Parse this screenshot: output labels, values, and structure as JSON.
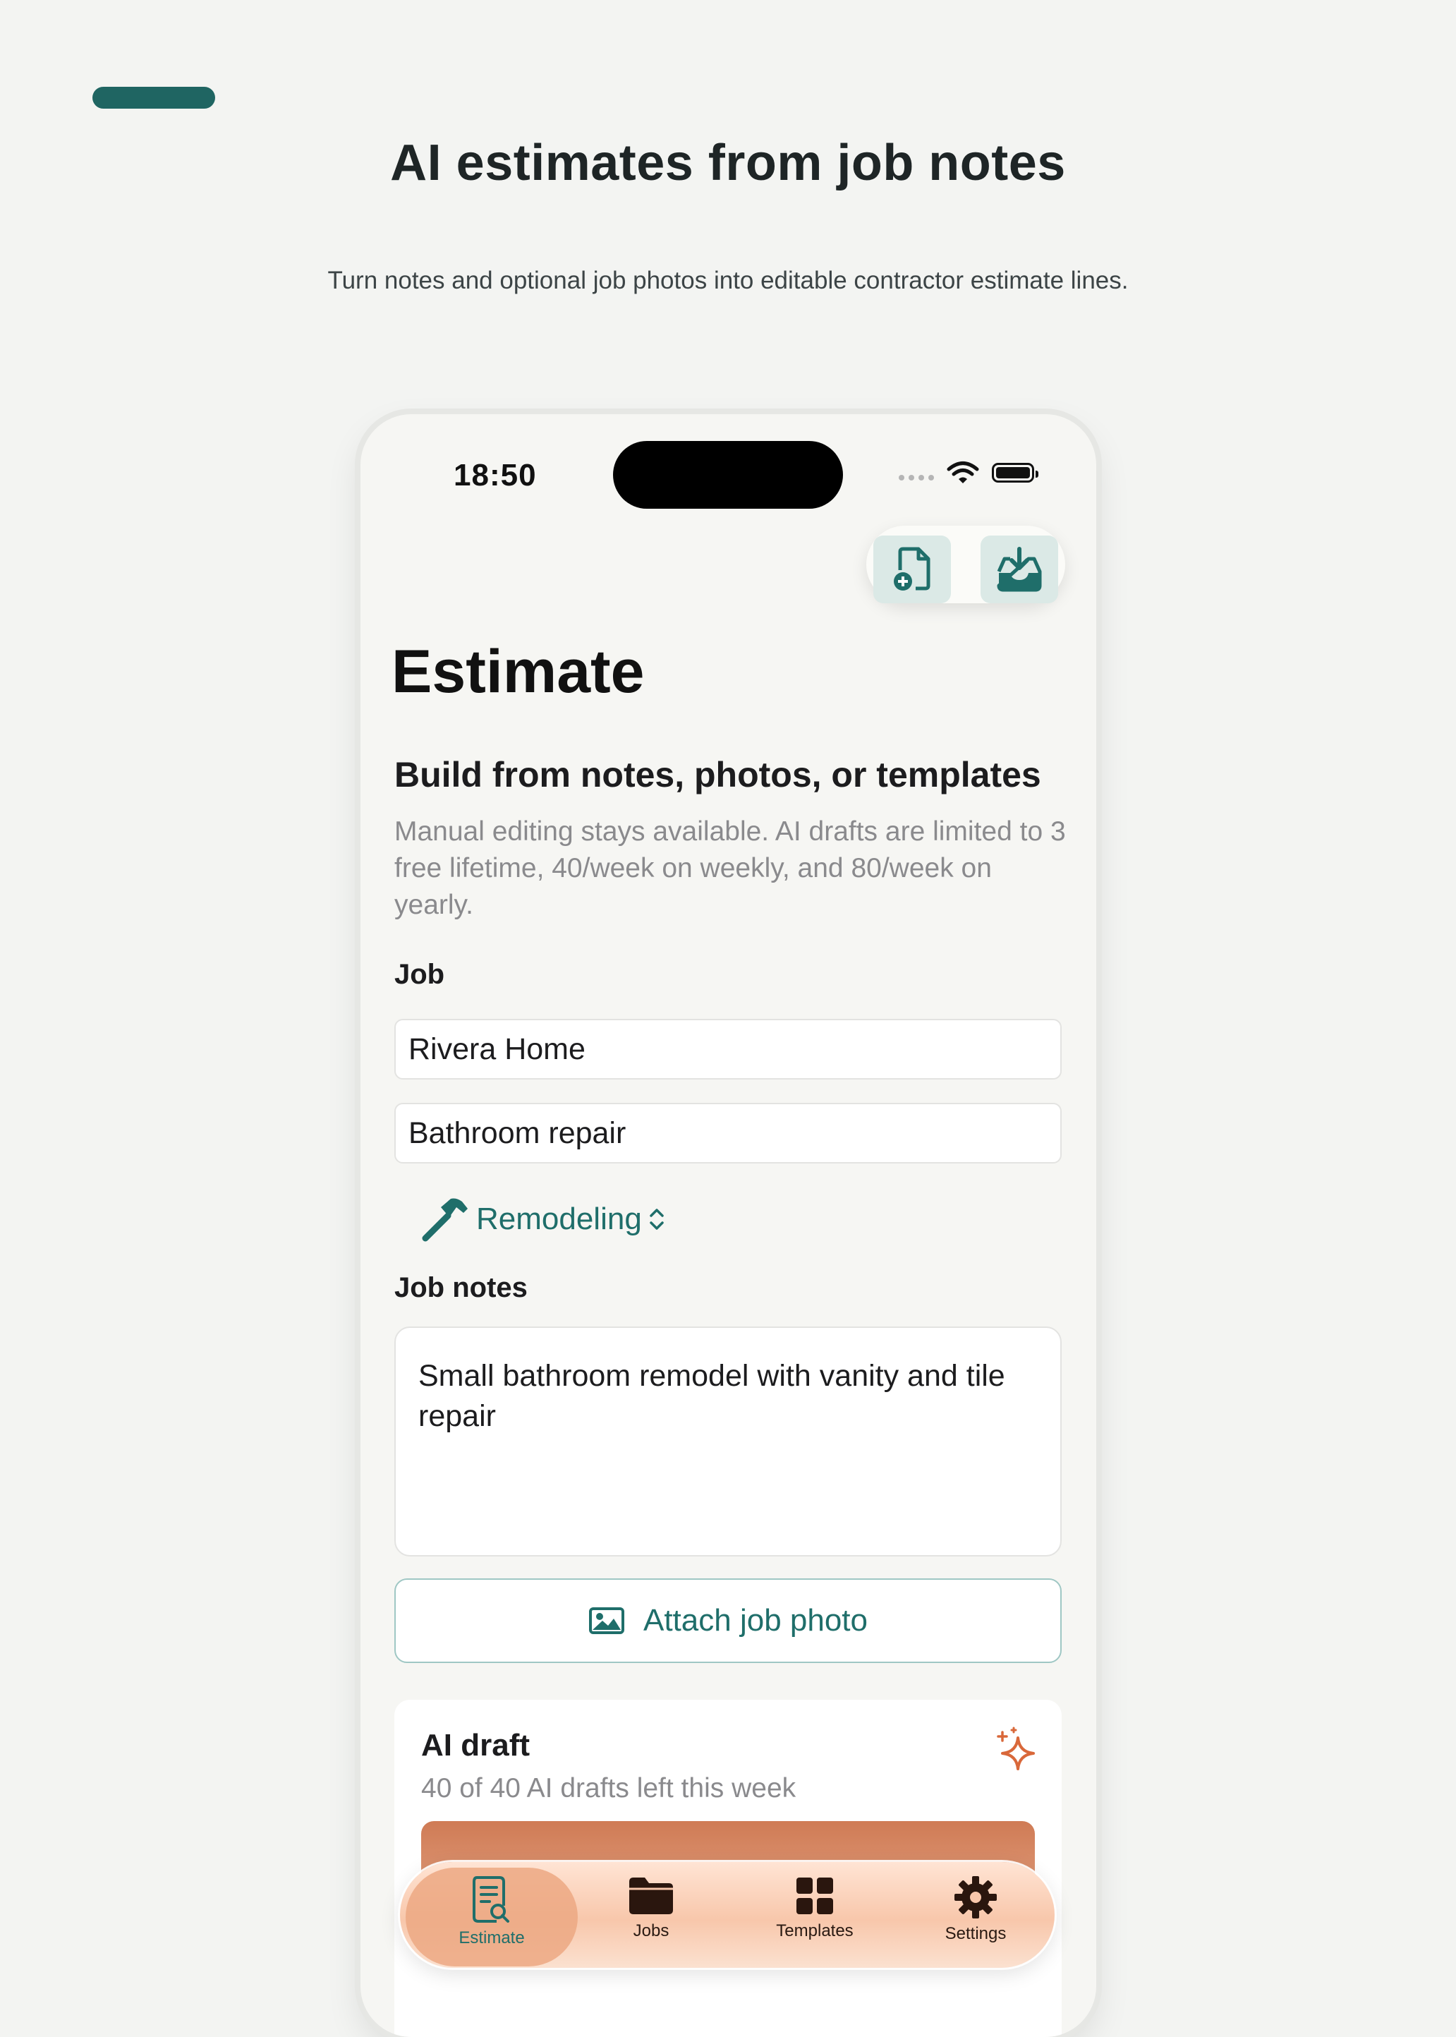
{
  "hero": {
    "title": "AI estimates from job notes",
    "subtitle": "Turn notes and optional job photos into editable contractor estimate lines."
  },
  "status_bar": {
    "time": "18:50"
  },
  "toolbar": {
    "icons": [
      "new-document-icon",
      "import-tray-icon"
    ]
  },
  "screen": {
    "title": "Estimate",
    "section_title": "Build from notes, photos, or templates",
    "section_description": "Manual editing stays available. AI drafts are limited to 3 free lifetime, 40/week on weekly, and 80/week on yearly."
  },
  "job": {
    "label": "Job",
    "client_value": "Rivera Home",
    "title_value": "Bathroom repair",
    "trade": "Remodeling"
  },
  "notes": {
    "label": "Job notes",
    "value": "Small bathroom remodel with vanity and tile repair"
  },
  "attach": {
    "label": "Attach job photo"
  },
  "ai_draft": {
    "title": "AI draft",
    "quota": "40 of 40 AI drafts left this week"
  },
  "tabs": [
    {
      "label": "Estimate",
      "icon": "estimate-doc-icon",
      "active": true
    },
    {
      "label": "Jobs",
      "icon": "folder-icon",
      "active": false
    },
    {
      "label": "Templates",
      "icon": "grid-icon",
      "active": false
    },
    {
      "label": "Settings",
      "icon": "gear-icon",
      "active": false
    }
  ],
  "colors": {
    "brand": "#1f6e6a",
    "accent_pill": "#1f6562",
    "ai_accent": "#d9683a",
    "background": "#f3f4f2"
  }
}
